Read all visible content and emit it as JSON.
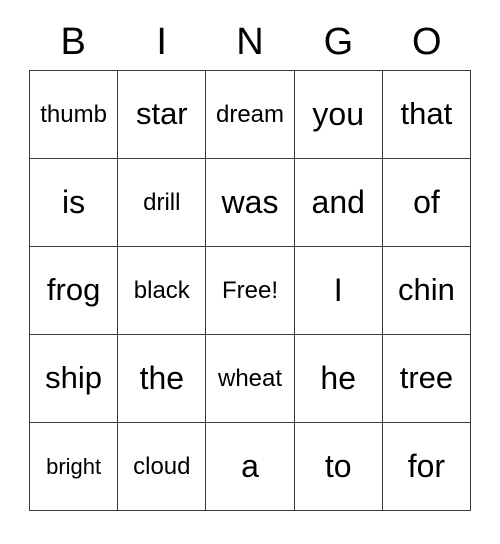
{
  "card": {
    "title": "BINGO",
    "headers": [
      "B",
      "I",
      "N",
      "G",
      "O"
    ],
    "free_space_label": "Free!",
    "free_space_position": {
      "row": 2,
      "column": 2
    },
    "colors": {
      "background": "#ffffff",
      "border": "#3a3a3a",
      "text": "#000000"
    },
    "grid": [
      [
        "thumb",
        "star",
        "dream",
        "you",
        "that"
      ],
      [
        "is",
        "drill",
        "was",
        "and",
        "of"
      ],
      [
        "frog",
        "black",
        "Free!",
        "I",
        "chin"
      ],
      [
        "ship",
        "the",
        "wheat",
        "he",
        "tree"
      ],
      [
        "bright",
        "cloud",
        "a",
        "to",
        "for"
      ]
    ]
  }
}
